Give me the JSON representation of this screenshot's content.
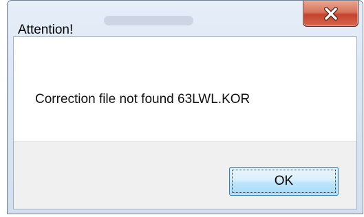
{
  "dialog": {
    "title": "Attention!",
    "message": "Correction file not found 63LWL.KOR",
    "buttons": {
      "ok_label": "OK"
    }
  },
  "icons": {
    "close": "close-icon"
  },
  "colors": {
    "close_button": "#c5432c",
    "ok_button_border": "#3c7fb1",
    "button_bar": "#f0f0f0"
  }
}
